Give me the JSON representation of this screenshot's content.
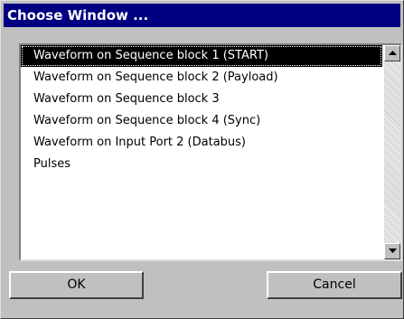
{
  "dialog": {
    "title": "Choose Window ..."
  },
  "list": {
    "items": [
      "Waveform on Sequence block 1 (START)",
      "Waveform on Sequence block 2 (Payload)",
      "Waveform on Sequence block 3",
      "Waveform on Sequence block 4 (Sync)",
      "Waveform on Input Port 2 (Databus)",
      "Pulses"
    ],
    "selected_index": 0
  },
  "buttons": {
    "ok_label": "OK",
    "cancel_label": "Cancel"
  },
  "scrollbar": {
    "up_icon": "arrow-up-icon",
    "down_icon": "arrow-down-icon"
  },
  "colors": {
    "title_bar": "#000080",
    "selection": "#000000",
    "face": "#c0c0c0"
  }
}
